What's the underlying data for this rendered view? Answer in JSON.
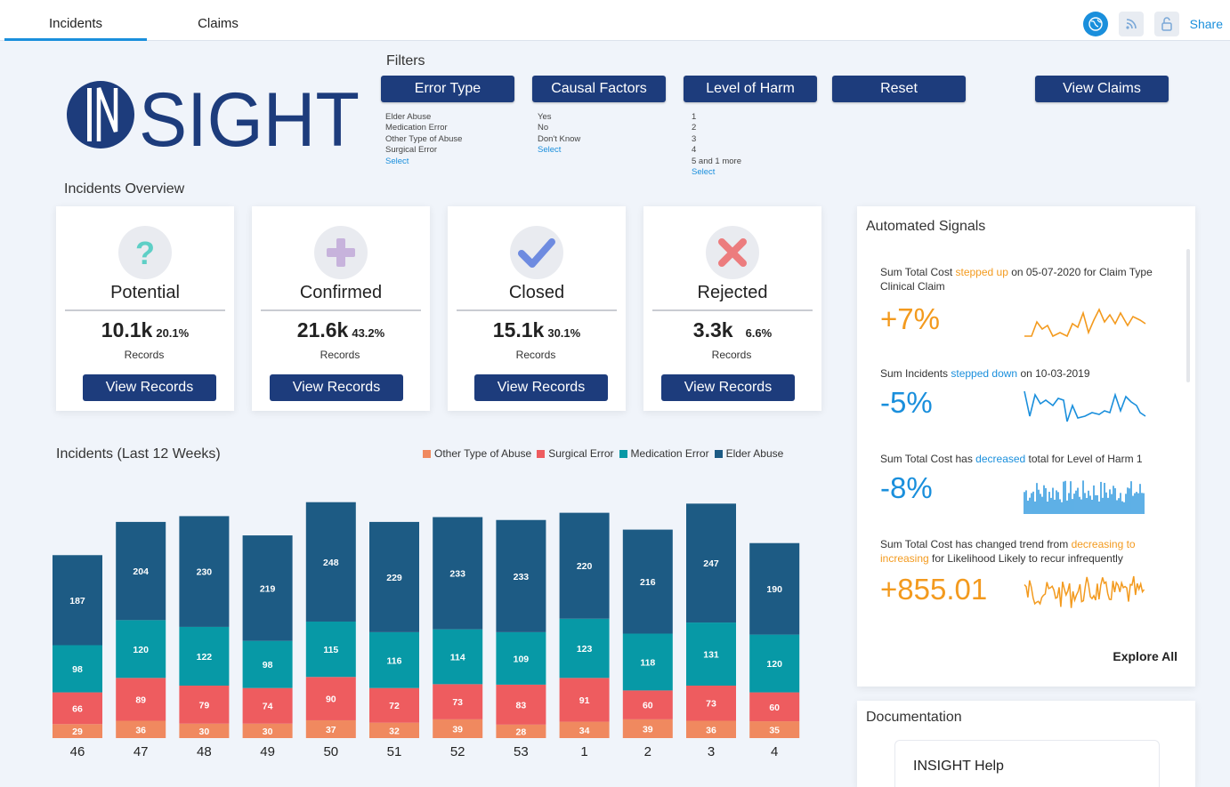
{
  "tabs": [
    {
      "label": "Incidents",
      "active": true
    },
    {
      "label": "Claims",
      "active": false
    }
  ],
  "top_actions": {
    "share_label": "Share",
    "icons": [
      "globe-icon",
      "rss-icon",
      "lock-icon"
    ]
  },
  "logo": {
    "text": "INSIGHT"
  },
  "filters": {
    "title": "Filters",
    "buttons": [
      "Error Type",
      "Causal Factors",
      "Level of Harm",
      "Reset",
      "View Claims"
    ],
    "error_type": {
      "items": [
        "Elder Abuse",
        "Medication Error",
        "Other Type of Abuse",
        "Surgical Error"
      ],
      "select": "Select"
    },
    "causal_factors": {
      "items": [
        "Yes",
        "No",
        "Don't Know"
      ],
      "select": "Select"
    },
    "level_of_harm": {
      "items": [
        "1",
        "2",
        "3",
        "4",
        "5 and 1 more"
      ],
      "select": "Select"
    }
  },
  "overview": {
    "title": "Incidents Overview",
    "cards": [
      {
        "title": "Potential",
        "value": "10.1k",
        "pct": "20.1%",
        "records_label": "Records",
        "button": "View Records",
        "icon": "question-icon",
        "icon_color": "#5ecfc6"
      },
      {
        "title": "Confirmed",
        "value": "21.6k",
        "pct": "43.2%",
        "records_label": "Records",
        "button": "View Records",
        "icon": "plus-icon",
        "icon_color": "#c7b3dc"
      },
      {
        "title": "Closed",
        "value": "15.1k",
        "pct": "30.1%",
        "records_label": "Records",
        "button": "View Records",
        "icon": "check-icon",
        "icon_color": "#6e8be0"
      },
      {
        "title": "Rejected",
        "value": "3.3k",
        "pct": "6.6%",
        "records_label": "Records",
        "button": "View Records",
        "icon": "x-icon",
        "icon_color": "#ec7c7e"
      }
    ]
  },
  "chart_data": {
    "type": "bar",
    "stacked": true,
    "title": "Incidents (Last 12 Weeks)",
    "categories": [
      "46",
      "47",
      "48",
      "49",
      "50",
      "51",
      "52",
      "53",
      "1",
      "2",
      "3",
      "4"
    ],
    "series": [
      {
        "name": "Other Type of Abuse",
        "color": "#f0895f",
        "values": [
          29,
          36,
          30,
          30,
          37,
          32,
          39,
          28,
          34,
          39,
          36,
          35
        ]
      },
      {
        "name": "Surgical Error",
        "color": "#ee5c5f",
        "values": [
          66,
          89,
          79,
          74,
          90,
          72,
          73,
          83,
          91,
          60,
          73,
          60
        ]
      },
      {
        "name": "Medication Error",
        "color": "#0799a6",
        "values": [
          98,
          120,
          122,
          98,
          115,
          116,
          114,
          109,
          123,
          118,
          131,
          120
        ]
      },
      {
        "name": "Elder Abuse",
        "color": "#1d5b84",
        "values": [
          187,
          204,
          230,
          219,
          248,
          229,
          233,
          233,
          220,
          216,
          247,
          190
        ]
      }
    ],
    "legend_position": "top-right",
    "grid": false
  },
  "signals": {
    "title": "Automated Signals",
    "items": [
      {
        "parts": [
          {
            "t": "Sum Total Cost ",
            "c": ""
          },
          {
            "t": "stepped up",
            "c": "o"
          },
          {
            "t": " on 05-07-2020 for Claim Type Clinical Claim",
            "c": ""
          }
        ],
        "value": "+7%",
        "tone": "o"
      },
      {
        "parts": [
          {
            "t": "Sum Incidents ",
            "c": ""
          },
          {
            "t": "stepped down",
            "c": "b"
          },
          {
            "t": " on 10-03-2019",
            "c": ""
          }
        ],
        "value": "-5%",
        "tone": "b"
      },
      {
        "parts": [
          {
            "t": "Sum Total Cost has ",
            "c": ""
          },
          {
            "t": "decreased",
            "c": "b"
          },
          {
            "t": " total for Level of Harm 1",
            "c": ""
          }
        ],
        "value": "-8%",
        "tone": "b"
      },
      {
        "parts": [
          {
            "t": "Sum Total Cost has changed trend from ",
            "c": ""
          },
          {
            "t": "decreasing to increasing",
            "c": "o"
          },
          {
            "t": " for Likelihood Likely to recur infrequently",
            "c": ""
          }
        ],
        "value": "+855.01",
        "tone": "o"
      }
    ],
    "explore_label": "Explore All"
  },
  "documentation": {
    "title": "Documentation",
    "help_label": "INSIGHT Help"
  },
  "colors": {
    "navy": "#1d3c7c",
    "accent": "#1a8fdc",
    "orange": "#f39a1e"
  }
}
